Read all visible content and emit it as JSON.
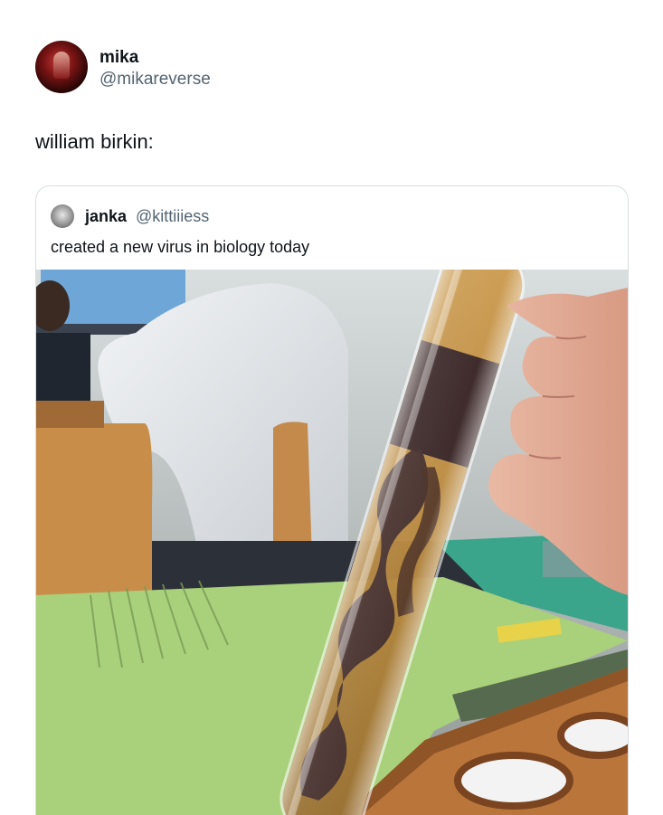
{
  "post": {
    "author_name": "mika",
    "author_handle": "@mikareverse",
    "text": "william birkin:",
    "avatar_icon": "profile-photo-icon"
  },
  "quoted_post": {
    "author_name": "janka",
    "author_handle": "@kittiiiess",
    "text": "created a new virus in biology today",
    "avatar_icon": "profile-photo-icon",
    "photo": "test-tube-photo"
  }
}
